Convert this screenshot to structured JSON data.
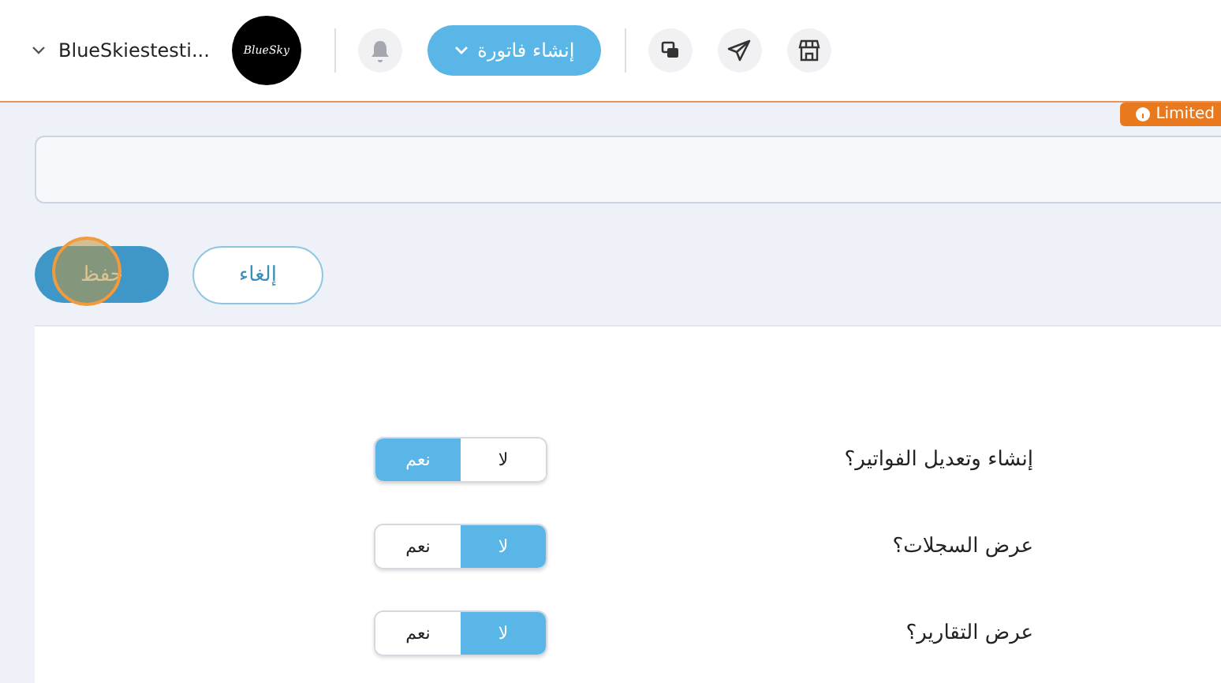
{
  "header": {
    "account": "BlueSkiestesti...",
    "logo": "BlueSky",
    "create_button": "إنشاء فاتورة"
  },
  "badge": "Limited",
  "buttons": {
    "save": "حفظ",
    "cancel": "إلغاء",
    "save_highlighted": true
  },
  "permissions": [
    {
      "label": "إنشاء وتعديل الفواتير؟",
      "options": [
        {
          "label": "لا",
          "selected": false
        },
        {
          "label": "نعم",
          "selected": true
        }
      ]
    },
    {
      "label": "عرض السجلات؟",
      "options": [
        {
          "label": "لا",
          "selected": true
        },
        {
          "label": "نعم",
          "selected": false
        }
      ]
    },
    {
      "label": "عرض التقارير؟",
      "options": [
        {
          "label": "لا",
          "selected": true
        },
        {
          "label": "نعم",
          "selected": false
        }
      ]
    }
  ]
}
